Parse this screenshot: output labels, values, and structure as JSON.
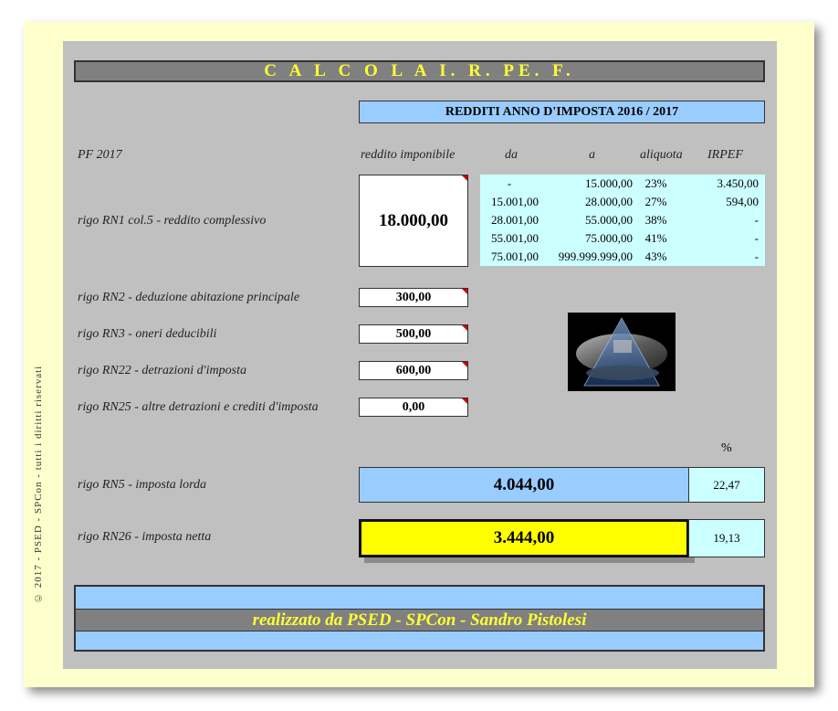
{
  "copyright": "© 2017 - PSED - SPCon - tutti i diritti riservati",
  "title": "C A L C O L A   I. R. PE. F.",
  "subtitle": "REDDITI ANNO D'IMPOSTA 2016 / 2017",
  "headers": {
    "pf": "PF 2017",
    "reddito": "reddito imponibile",
    "da": "da",
    "a": "a",
    "aliquota": "aliquota",
    "irpef": "IRPEF"
  },
  "reddito_complessivo": {
    "label": "rigo RN1 col.5 - reddito complessivo",
    "value": "18.000,00"
  },
  "brackets": [
    {
      "da": "-",
      "a": "15.000,00",
      "aliquota": "23%",
      "irpef": "3.450,00"
    },
    {
      "da": "15.001,00",
      "a": "28.000,00",
      "aliquota": "27%",
      "irpef": "594,00"
    },
    {
      "da": "28.001,00",
      "a": "55.000,00",
      "aliquota": "38%",
      "irpef": "-"
    },
    {
      "da": "55.001,00",
      "a": "75.000,00",
      "aliquota": "41%",
      "irpef": "-"
    },
    {
      "da": "75.001,00",
      "a": "999.999.999,00",
      "aliquota": "43%",
      "irpef": "-"
    }
  ],
  "inputs": [
    {
      "label": "rigo RN2 - deduzione abitazione principale",
      "value": "300,00"
    },
    {
      "label": "rigo RN3 - oneri deducibili",
      "value": "500,00"
    },
    {
      "label": "rigo RN22 - detrazioni d'imposta",
      "value": "600,00"
    },
    {
      "label": "rigo RN25 - altre detrazioni e crediti d'imposta",
      "value": "0,00"
    }
  ],
  "percent_header": "%",
  "imposta_lorda": {
    "label": "rigo RN5 - imposta lorda",
    "value": "4.044,00",
    "pct": "22,47"
  },
  "imposta_netta": {
    "label": "rigo RN26 - imposta netta",
    "value": "3.444,00",
    "pct": "19,13"
  },
  "footer": "realizzato da PSED - SPCon - Sandro Pistolesi",
  "colors": {
    "sheet": "#c0c0c0",
    "frame": "#ffffcc",
    "title_bg": "#808080",
    "title_text": "#ffff33",
    "light_blue": "#99ccff",
    "cyan": "#ccffff",
    "yellow": "#ffff00"
  }
}
